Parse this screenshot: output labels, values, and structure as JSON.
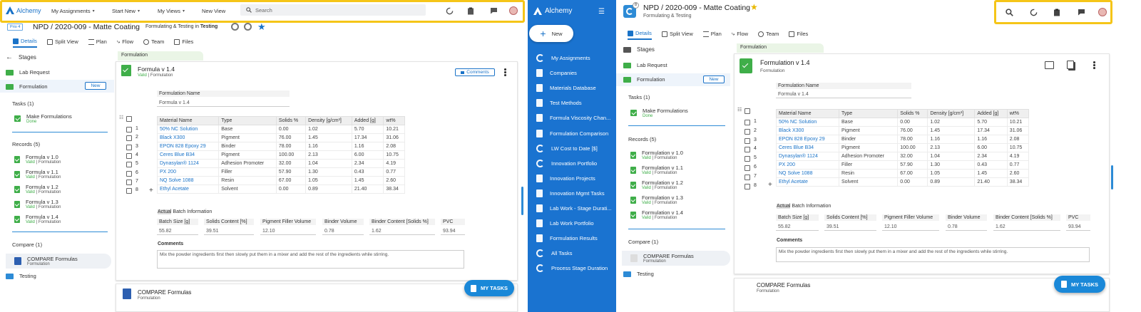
{
  "app": {
    "name": "Alchemy"
  },
  "left": {
    "topnav": {
      "my_assignments": "My Assignments",
      "start_new": "Start New",
      "my_views": "My Views",
      "new_view": "New View",
      "search_placeholder": "Search"
    },
    "record": {
      "prio": "Prio 4",
      "title": "NPD / 2020-009 - Matte Coating",
      "subtitle_prefix": "Formulating & Testing in",
      "subtitle_stage": "Testing"
    },
    "tabs": [
      "Details",
      "Split View",
      "Plan",
      "Flow",
      "Team",
      "Files"
    ],
    "sidebar": {
      "stages_title": "Stages",
      "lab_request": "Lab Request",
      "formulation": "Formulation",
      "new_badge": "New",
      "tasks_title": "Tasks (1)",
      "task_name": "Make Formulations",
      "task_status": "Done",
      "records_title": "Records (5)",
      "records": [
        {
          "name": "Formula v 1.0",
          "status": "Valid",
          "type": "Formulation"
        },
        {
          "name": "Formula v 1.1",
          "status": "Valid",
          "type": "Formulation"
        },
        {
          "name": "Formula v 1.2",
          "status": "Valid",
          "type": "Formulation"
        },
        {
          "name": "Formula v 1.3",
          "status": "Valid",
          "type": "Formulation"
        },
        {
          "name": "Formula v 1.4",
          "status": "Valid",
          "type": "Formulation"
        }
      ],
      "compare_title": "Compare (1)",
      "compare_name": "COMPARE Formulas",
      "compare_type": "Formulation",
      "testing": "Testing"
    },
    "section_tag": "Formulation",
    "card": {
      "title": "Formula v 1.4",
      "status": "Valid",
      "type": "Formulation",
      "comments_btn": "Comments"
    },
    "compare_card": {
      "title": "COMPARE Formulas",
      "type": "Formulation"
    },
    "fab": "MY TASKS"
  },
  "formulation": {
    "name_label": "Formulation Name",
    "name_value": "Formula v 1.4",
    "columns": [
      "Material Name",
      "Type",
      "Solids %",
      "Density [g/cm³]",
      "Added [g]",
      "wt%"
    ],
    "rows": [
      {
        "n": "1",
        "name": "50% NC Solution",
        "type": "Base",
        "solids": "0.00",
        "density": "1.02",
        "added": "5.70",
        "wt": "10.21"
      },
      {
        "n": "2",
        "name": "Black X300",
        "type": "Pigment",
        "solids": "76.00",
        "density": "1.45",
        "added": "17.34",
        "wt": "31.06"
      },
      {
        "n": "3",
        "name": "EPON 828 Epoxy 29",
        "type": "Binder",
        "solids": "78.00",
        "density": "1.16",
        "added": "1.16",
        "wt": "2.08"
      },
      {
        "n": "4",
        "name": "Ceres Blue B34",
        "type": "Pigment",
        "solids": "100.00",
        "density": "2.13",
        "added": "6.00",
        "wt": "10.75"
      },
      {
        "n": "5",
        "name": "Dynasylan® 1124",
        "type": "Adhesion Promoter",
        "solids": "32.00",
        "density": "1.04",
        "added": "2.34",
        "wt": "4.19"
      },
      {
        "n": "6",
        "name": "PX 200",
        "type": "Filler",
        "solids": "57.90",
        "density": "1.30",
        "added": "0.43",
        "wt": "0.77"
      },
      {
        "n": "7",
        "name": "NQ Solve 1088",
        "type": "Resin",
        "solids": "67.00",
        "density": "1.05",
        "added": "1.45",
        "wt": "2.60"
      },
      {
        "n": "8",
        "name": "Ethyl Acetate",
        "type": "Solvent",
        "solids": "0.00",
        "density": "0.89",
        "added": "21.40",
        "wt": "38.34"
      }
    ],
    "batch_title_a": "Actual",
    "batch_title_b": "Batch Information",
    "batch_fields": [
      {
        "label": "Batch Size [g]",
        "value": "55.82"
      },
      {
        "label": "Solids Content [%]",
        "value": "39.51"
      },
      {
        "label": "Pigment Filler Volume",
        "value": "12.10"
      },
      {
        "label": "Binder Volume",
        "value": "0.78"
      },
      {
        "label": "Binder Content [Solids %]",
        "value": "1.62"
      },
      {
        "label": "PVC",
        "value": "93.94"
      }
    ],
    "comments_label": "Comments",
    "comments_text": "Mix the powder ingredients first then slowly put them in a mixer and add the rest of the ingredients while stirring."
  },
  "bluebar": {
    "new_btn": "New",
    "items": [
      "My Assignments",
      "Companies",
      "Materials Database",
      "Test Methods",
      "Formula Viscosity Chan...",
      "Formulation Comparison",
      "LW Cost to Date [$]",
      "Innovation Portfolio",
      "Innovation Projects",
      "Innovation Mgmt Tasks",
      "Lab Work - Stage Durati...",
      "Lab Work Portfolio",
      "Formulation Results",
      "All Tasks",
      "Process Stage Duration"
    ]
  },
  "right": {
    "badge": "8",
    "title": "NPD / 2020-009 - Matte Coating",
    "subtitle": "Formulating & Testing",
    "tabs": [
      "Details",
      "Split View",
      "Plan",
      "Flow",
      "Team",
      "Files"
    ],
    "sidebar": {
      "stages_title": "Stages",
      "lab_request": "Lab Request",
      "formulation": "Formulation",
      "new_badge": "New",
      "tasks_title": "Tasks (1)",
      "task_name": "Make Formulations",
      "task_status": "Done",
      "records_title": "Records (5)",
      "records": [
        {
          "name": "Formulation v 1.0",
          "status": "Valid",
          "type": "Formulation"
        },
        {
          "name": "Formulation v 1.1",
          "status": "Valid",
          "type": "Formulation"
        },
        {
          "name": "Formulation v 1.2",
          "status": "Valid",
          "type": "Formulation"
        },
        {
          "name": "Formulation v 1.3",
          "status": "Valid",
          "type": "Formulation"
        },
        {
          "name": "Formulation v 1.4",
          "status": "Valid",
          "type": "Formulation"
        }
      ],
      "compare_title": "Compare (1)",
      "compare_name": "COMPARE Formulas",
      "compare_type": "Formulation",
      "testing": "Testing"
    },
    "section_tag": "Formulation",
    "card": {
      "title": "Formulation v 1.4",
      "type": "Formulation"
    },
    "compare_card": {
      "title": "COMPARE Formulas",
      "type": "Formulation"
    },
    "fab": "MY TASKS"
  }
}
